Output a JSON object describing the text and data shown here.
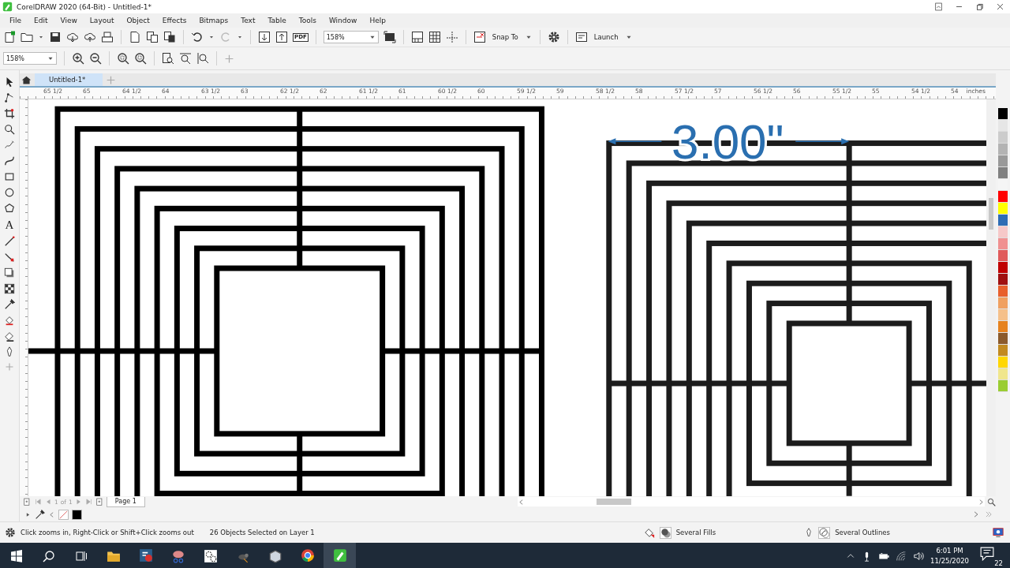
{
  "window": {
    "title": "CorelDRAW 2020 (64-Bit) - Untitled-1*"
  },
  "menu": [
    "File",
    "Edit",
    "View",
    "Layout",
    "Object",
    "Effects",
    "Bitmaps",
    "Text",
    "Table",
    "Tools",
    "Window",
    "Help"
  ],
  "toolbar": {
    "pdf_label": "PDF",
    "zoom": "158%",
    "snap_to": "Snap To",
    "launch": "Launch"
  },
  "property_bar": {
    "zoom": "158%"
  },
  "toolbox": {
    "text_tool": "A"
  },
  "document_tabs": [
    {
      "label": "Untitled-1*",
      "selected": true
    }
  ],
  "ruler": {
    "labels": [
      "65 1/2",
      "65",
      "64 1/2",
      "64",
      "63 1/2",
      "63",
      "62 1/2",
      "62",
      "61 1/2",
      "61",
      "60 1/2",
      "60",
      "59 1/2",
      "59",
      "58 1/2",
      "58",
      "57 1/2",
      "57",
      "56 1/2",
      "56",
      "55 1/2",
      "55",
      "54 1/2",
      "54"
    ],
    "unit": "inches"
  },
  "canvas": {
    "dimension_label": "3.00\""
  },
  "page_nav": {
    "current": "1",
    "of": "of",
    "total": "1",
    "page_tab": "Page 1"
  },
  "palette": [
    {
      "color": "#000000"
    },
    {
      "color": "#e6e6e6"
    },
    {
      "color": "#cccccc"
    },
    {
      "color": "#b3b3b3"
    },
    {
      "color": "#999999"
    },
    {
      "color": "#808080"
    },
    {
      "color": "#f5f5f5"
    },
    {
      "color": "#ff0000"
    },
    {
      "color": "#ffff00"
    },
    {
      "color": "#2e6db4"
    },
    {
      "color": "#f6c8c8"
    },
    {
      "color": "#f09090"
    },
    {
      "color": "#e05a5a"
    },
    {
      "color": "#c00000"
    },
    {
      "color": "#a01010"
    },
    {
      "color": "#e8602c"
    },
    {
      "color": "#f0a060"
    },
    {
      "color": "#f5c08a"
    },
    {
      "color": "#e6821e"
    },
    {
      "color": "#8b5a2b"
    },
    {
      "color": "#c28a20"
    },
    {
      "color": "#ffd700"
    },
    {
      "color": "#f0e68c"
    },
    {
      "color": "#9acd32"
    }
  ],
  "status_bar": {
    "hint": "Click zooms in, Right-Click or Shift+Click zooms out",
    "selection": "26 Objects Selected on Layer 1",
    "fill": "Several Fills",
    "outline": "Several Outlines"
  },
  "taskbar": {
    "time": "6:01 PM",
    "date": "11/25/2020",
    "notifications": "22"
  }
}
